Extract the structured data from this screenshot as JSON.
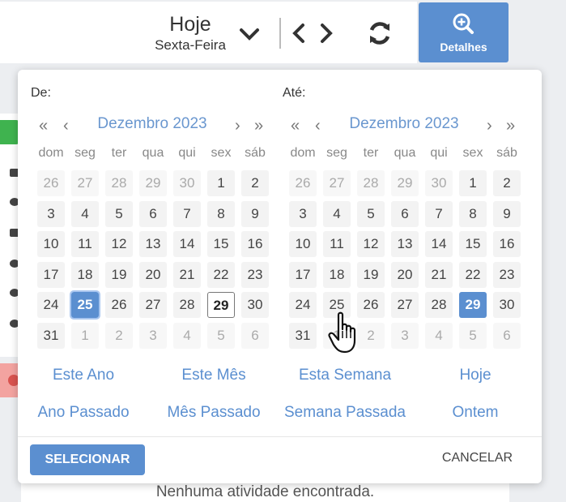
{
  "header": {
    "date_label": "Hoje",
    "weekday_label": "Sexta-Feira",
    "details_label": "Detalhes",
    "accent": "#5b8fd0"
  },
  "background": {
    "empty_message": "Nenhuma atividade encontrada."
  },
  "picker": {
    "from": {
      "label": "De:",
      "month_title": "Dezembro 2023",
      "weekdays": [
        "dom",
        "seg",
        "ter",
        "qua",
        "qui",
        "sex",
        "sáb"
      ],
      "weeks": [
        [
          "26",
          "27",
          "28",
          "29",
          "30",
          "1",
          "2"
        ],
        [
          "3",
          "4",
          "5",
          "6",
          "7",
          "8",
          "9"
        ],
        [
          "10",
          "11",
          "12",
          "13",
          "14",
          "15",
          "16"
        ],
        [
          "17",
          "18",
          "19",
          "20",
          "21",
          "22",
          "23"
        ],
        [
          "24",
          "25",
          "26",
          "27",
          "28",
          "29",
          "30"
        ],
        [
          "31",
          "1",
          "2",
          "3",
          "4",
          "5",
          "6"
        ]
      ],
      "selected_day": "25",
      "today_day": "29"
    },
    "to": {
      "label": "Até:",
      "month_title": "Dezembro 2023",
      "weekdays": [
        "dom",
        "seg",
        "ter",
        "qua",
        "qui",
        "sex",
        "sáb"
      ],
      "weeks": [
        [
          "26",
          "27",
          "28",
          "29",
          "30",
          "1",
          "2"
        ],
        [
          "3",
          "4",
          "5",
          "6",
          "7",
          "8",
          "9"
        ],
        [
          "10",
          "11",
          "12",
          "13",
          "14",
          "15",
          "16"
        ],
        [
          "17",
          "18",
          "19",
          "20",
          "21",
          "22",
          "23"
        ],
        [
          "24",
          "25",
          "26",
          "27",
          "28",
          "29",
          "30"
        ],
        [
          "31",
          "1",
          "2",
          "3",
          "4",
          "5",
          "6"
        ]
      ],
      "selected_day": "29"
    },
    "ranges": {
      "this_year": "Este Ano",
      "this_month": "Este Mês",
      "this_week": "Esta Semana",
      "today": "Hoje",
      "last_year": "Ano Passado",
      "last_month": "Mês Passado",
      "last_week": "Semana Passada",
      "yesterday": "Ontem"
    },
    "select_label": "SELECIONAR",
    "cancel_label": "CANCELAR"
  }
}
